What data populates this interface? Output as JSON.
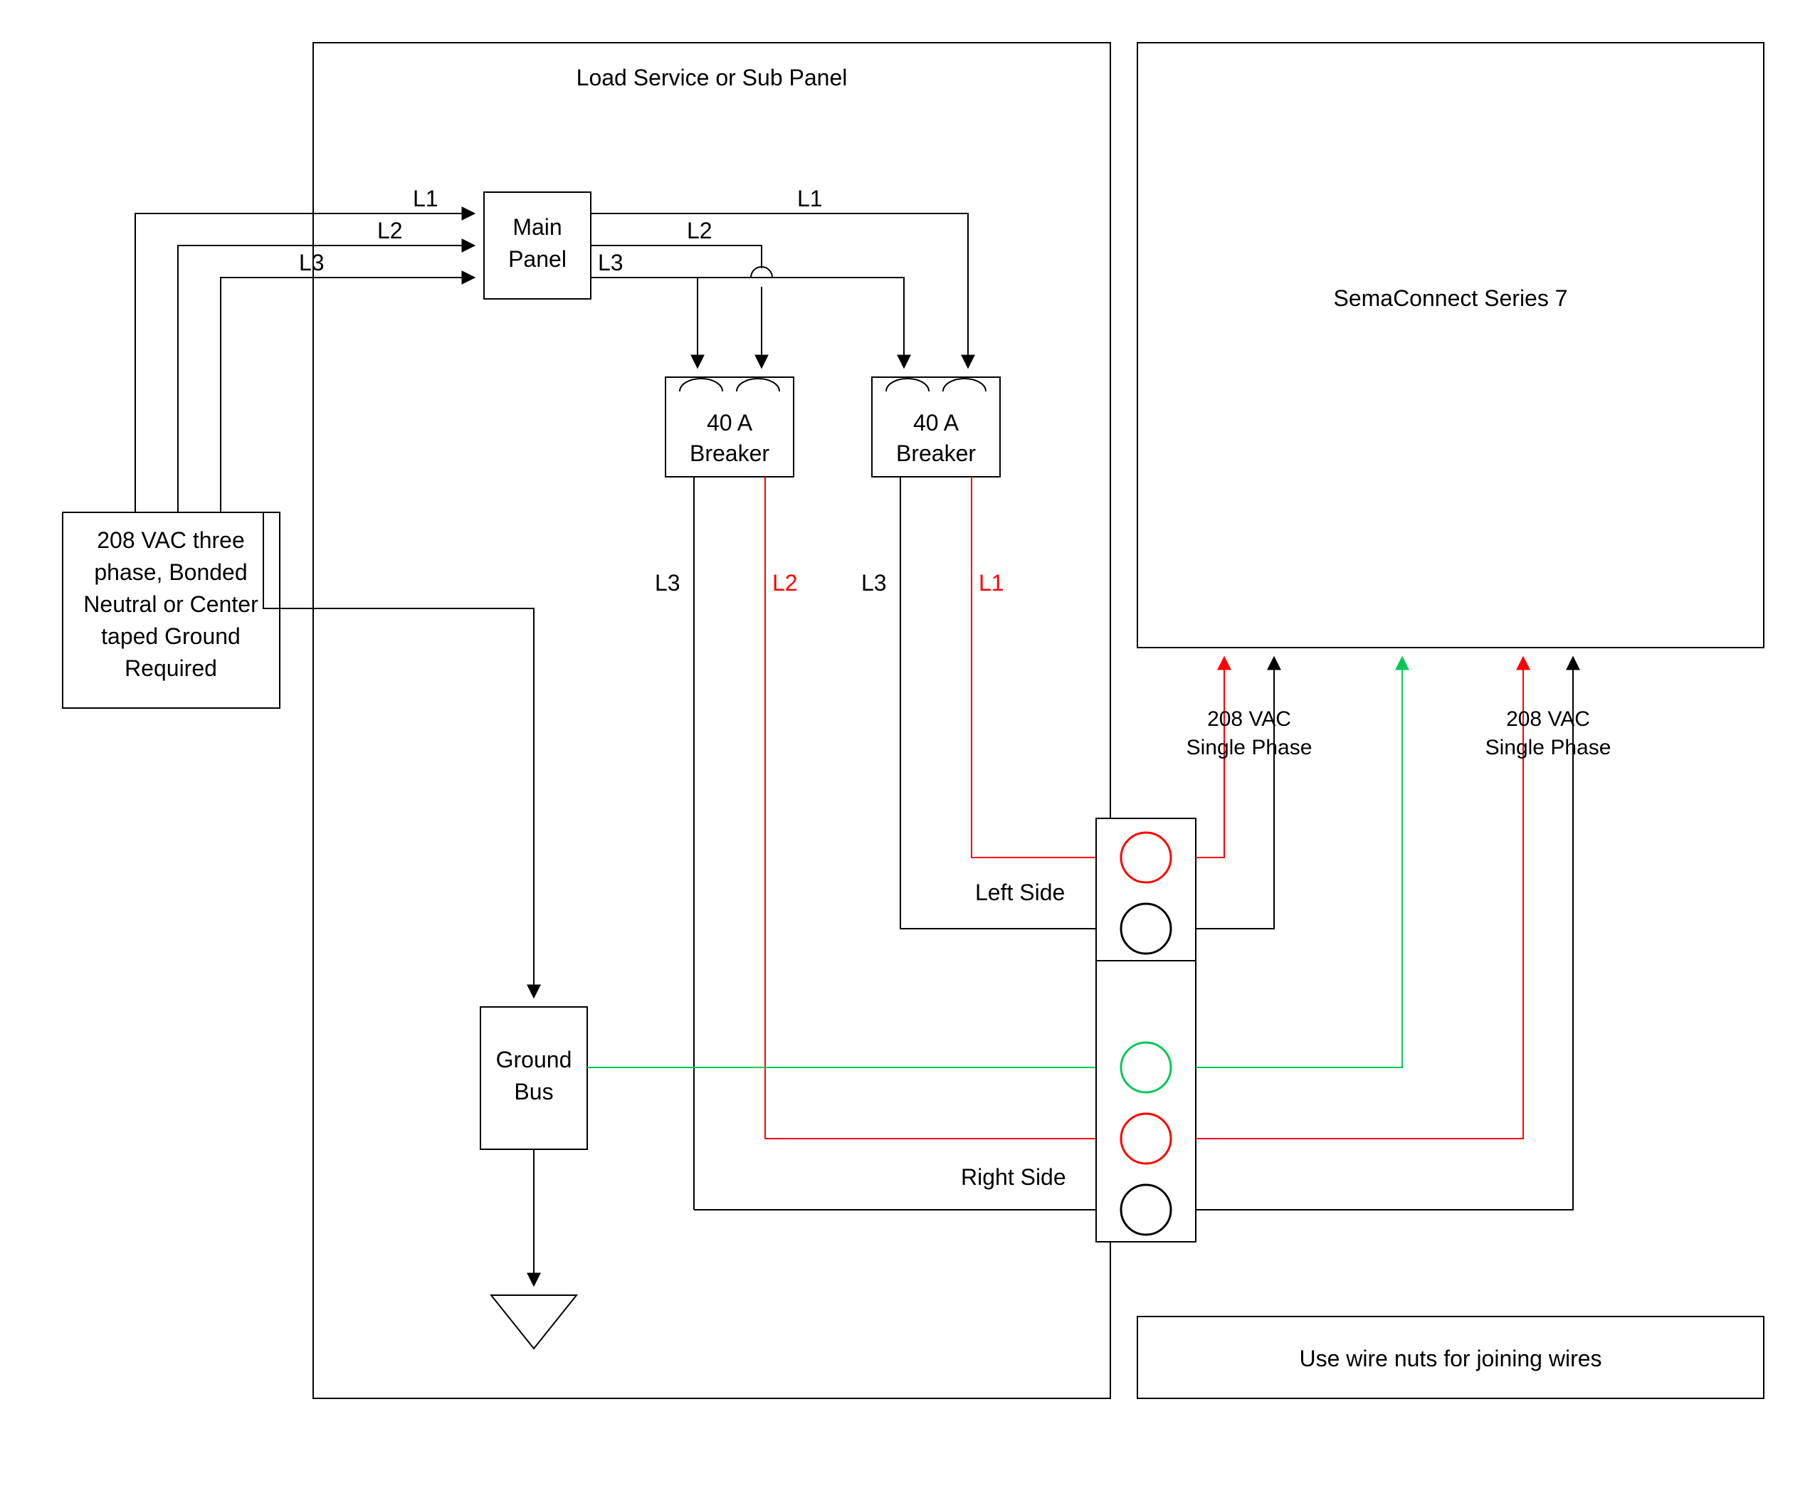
{
  "title": "Load Service or Sub Panel",
  "source_box": {
    "line1": "208 VAC three",
    "line2": "phase, Bonded",
    "line3": "Neutral or Center",
    "line4": "taped Ground",
    "line5": "Required"
  },
  "main_panel": {
    "line1": "Main",
    "line2": "Panel"
  },
  "breaker1": {
    "line1": "40 A",
    "line2": "Breaker"
  },
  "breaker2": {
    "line1": "40 A",
    "line2": "Breaker"
  },
  "ground_bus": {
    "line1": "Ground",
    "line2": "Bus"
  },
  "labels": {
    "L1": "L1",
    "L2": "L2",
    "L3": "L3",
    "left_side": "Left Side",
    "right_side": "Right Side",
    "phase1": "208 VAC",
    "phase1b": "Single Phase",
    "phase2": "208 VAC",
    "phase2b": "Single Phase"
  },
  "device": {
    "name": "SemaConnect Series 7"
  },
  "footer": "Use wire nuts for joining wires",
  "colors": {
    "black": "#000000",
    "red": "#ff0000",
    "green": "#06c755"
  }
}
